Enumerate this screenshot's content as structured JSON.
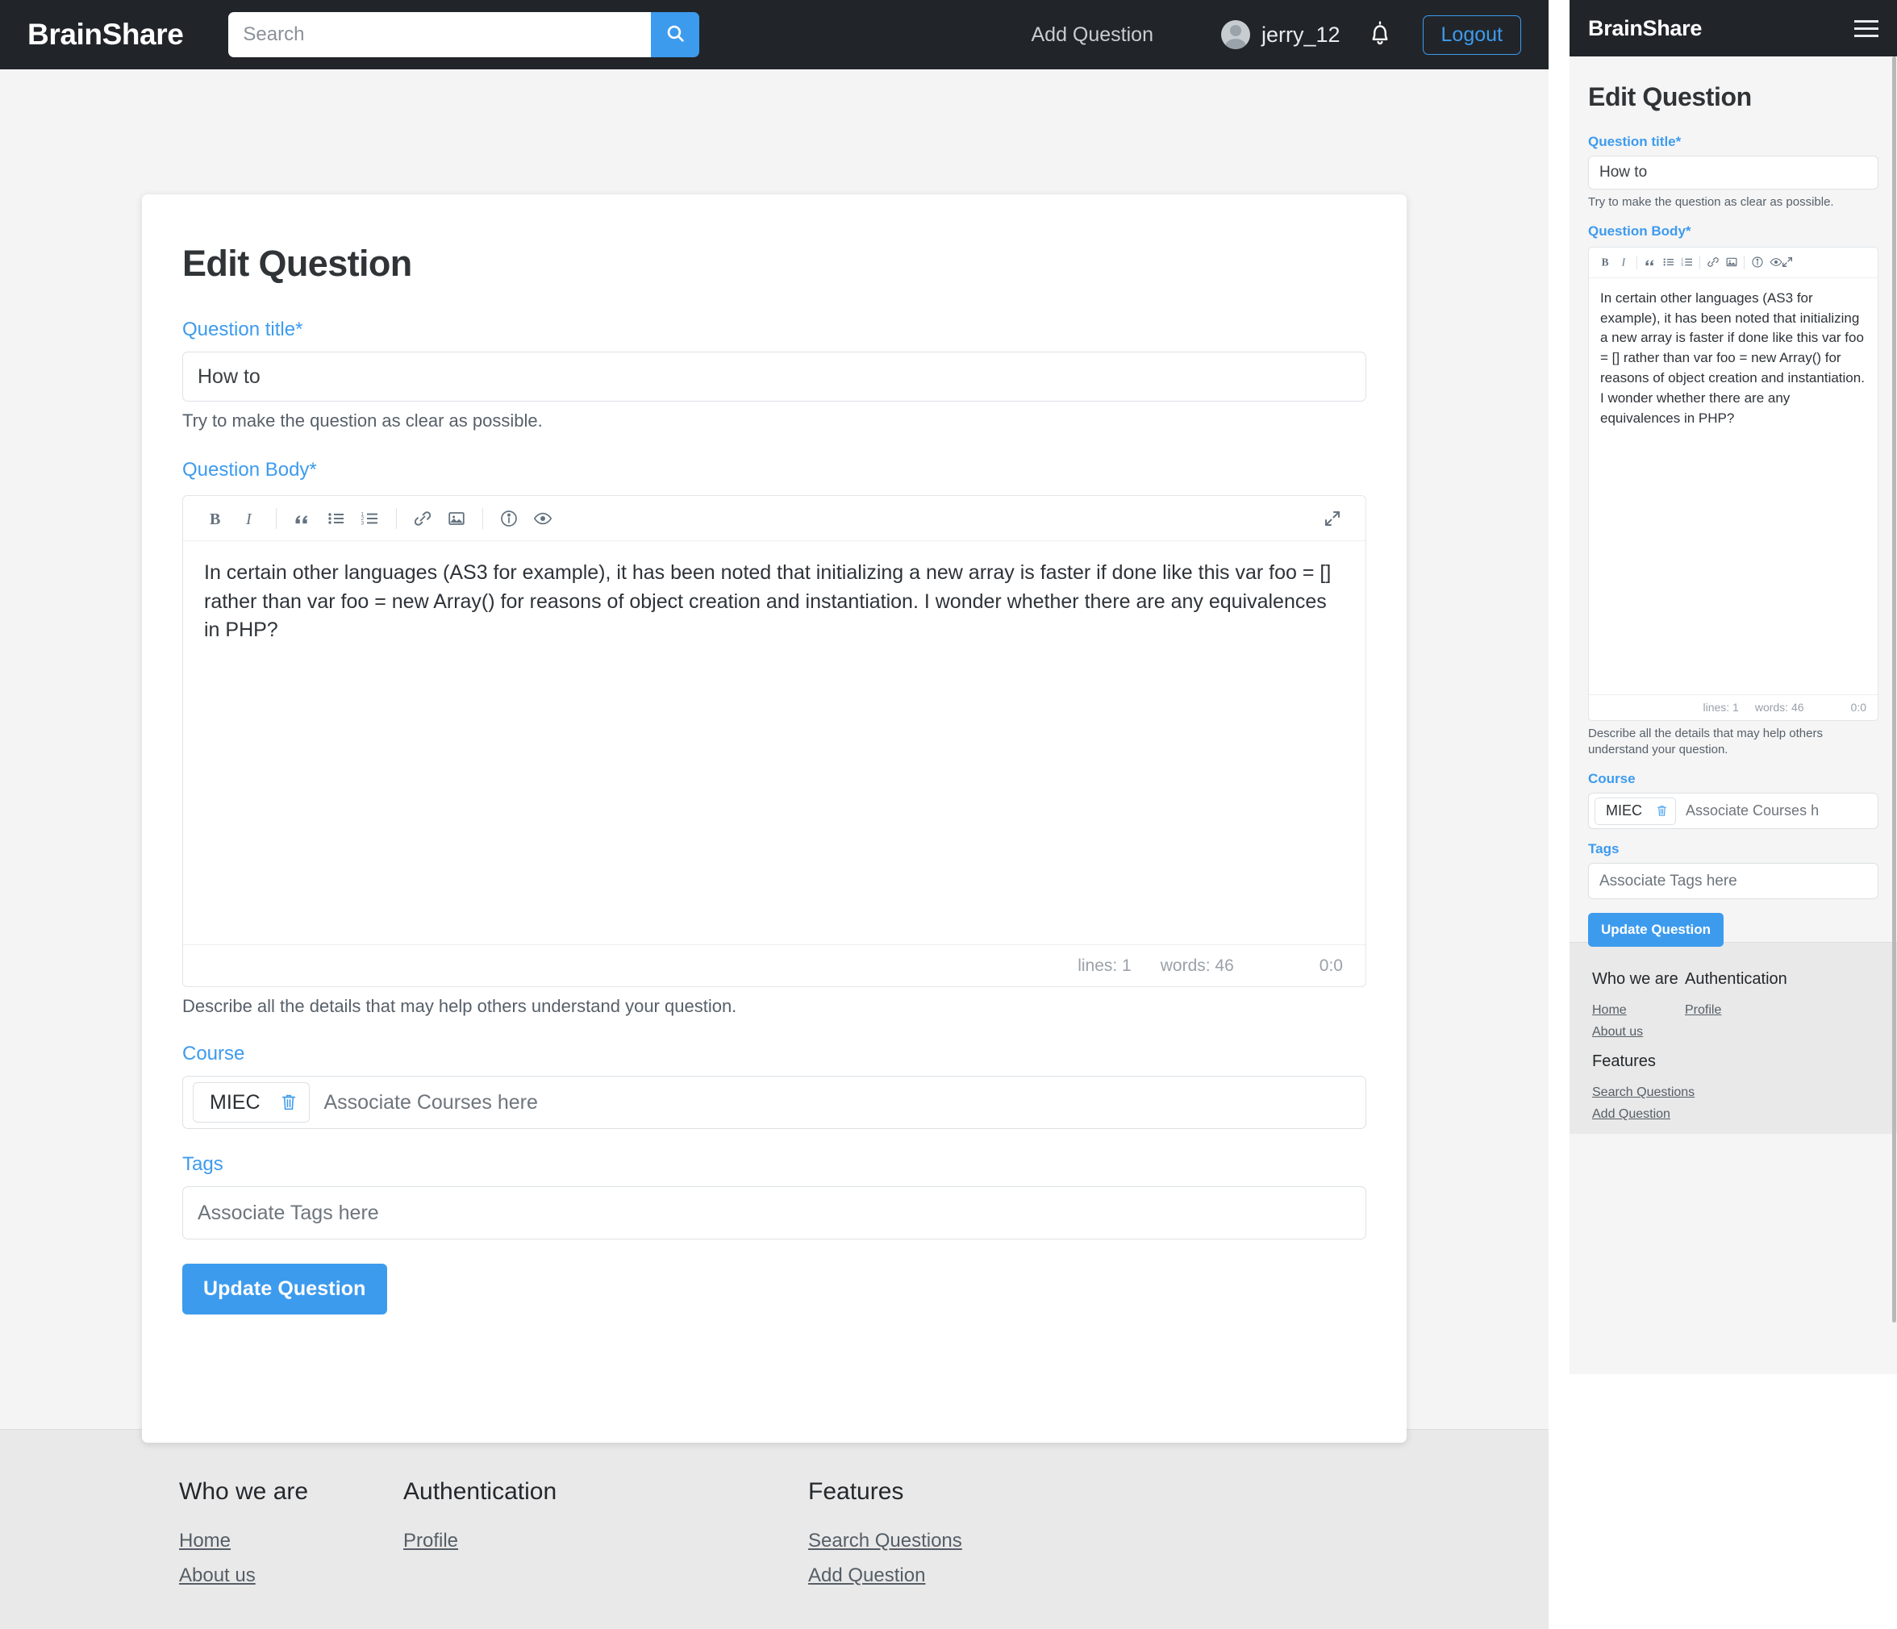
{
  "brand": "BrainShare",
  "navbar": {
    "search_placeholder": "Search",
    "search_value": "",
    "search_icon": "search-icon",
    "add_question_label": "Add Question",
    "username": "jerry_12",
    "bell_icon": "bell-icon",
    "logout_label": "Logout",
    "bg_color": "#212529",
    "accent_color": "#3d9bee"
  },
  "form": {
    "title": "Edit Question",
    "question_title_label": "Question title*",
    "question_title_value": "How to",
    "question_title_help": "Try to make the question as clear as possible.",
    "question_body_label": "Question Body*",
    "question_body_value": " In certain other languages (AS3 for example), it has been noted that initializing a new array is faster if done like this var foo = [] rather than var foo = new Array() for reasons of object creation and instantiation. I wonder whether there are any equivalences in PHP?",
    "question_body_help": "Describe all the details that may help others understand your question.",
    "course_label": "Course",
    "course_chips": [
      {
        "label": "MIEC",
        "delete_icon": "trash-icon"
      }
    ],
    "course_placeholder": "Associate Courses here",
    "course_placeholder_mobile": "Associate Courses h",
    "tags_label": "Tags",
    "tags_placeholder": "Associate Tags here",
    "tags_value": "",
    "submit_label": "Update Question"
  },
  "editor": {
    "toolbar": [
      {
        "name": "bold-icon",
        "title": "Bold"
      },
      {
        "name": "italic-icon",
        "title": "Italic"
      },
      {
        "name": "quote-icon",
        "title": "Quote"
      },
      {
        "name": "unordered-list-icon",
        "title": "Unordered list"
      },
      {
        "name": "ordered-list-icon",
        "title": "Ordered list"
      },
      {
        "name": "link-icon",
        "title": "Link"
      },
      {
        "name": "image-icon",
        "title": "Image"
      },
      {
        "name": "info-icon",
        "title": "Markdown info"
      },
      {
        "name": "preview-eye-icon",
        "title": "Preview"
      },
      {
        "name": "expand-icon",
        "title": "Fullscreen"
      }
    ],
    "status_lines": "lines: 1",
    "status_words": "words: 46",
    "status_cursor": "0:0"
  },
  "footer": {
    "columns": [
      {
        "heading": "Who we are",
        "links": [
          "Home",
          "About us"
        ]
      },
      {
        "heading": "Authentication",
        "links": [
          "Profile"
        ]
      },
      {
        "heading": "Features",
        "links": [
          "Search Questions",
          "Add Question"
        ]
      }
    ]
  },
  "mobile": {
    "brand": "BrainShare",
    "menu_icon": "hamburger-icon"
  }
}
